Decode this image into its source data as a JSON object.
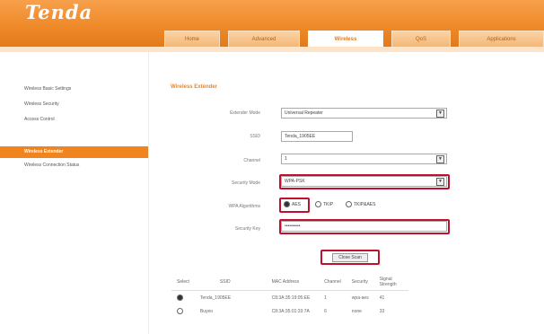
{
  "logo": "Tenda",
  "tabs": [
    "Home",
    "Advanced",
    "Wireless",
    "QoS",
    "Applications"
  ],
  "sidebar": [
    "Wireless Basic Settings",
    "Wireless Security",
    "Access Control",
    "Wireless Extender",
    "Wireless Connection Status"
  ],
  "section_title": "Wireless Extender",
  "fields": {
    "extender_mode": {
      "label": "Extender Mode",
      "value": "Universal Repeater"
    },
    "ssid": {
      "label": "SSID",
      "value": "Tenda_1905EE"
    },
    "channel": {
      "label": "Channel",
      "value": "1"
    },
    "security_mode": {
      "label": "Security Mode",
      "value": "WPA-PSK"
    },
    "wpa_algorithms": {
      "label": "WPA Algorithms",
      "options": [
        "AES",
        "TKIP",
        "TKIP&AES"
      ]
    },
    "security_key": {
      "label": "Security Key",
      "value": "••••••••••"
    }
  },
  "open_scan_label": "Close Scan",
  "table": {
    "headers": [
      "Select",
      "SSID",
      "MAC Address",
      "Channel",
      "Security",
      "Signal Strength"
    ],
    "rows": [
      [
        "Tenda_1905EE",
        "C8:3A:35:19:05:EE",
        "1",
        "wpa-aes",
        "41"
      ],
      [
        "Buyeo",
        "C8:3A:35:01:33:7A",
        "6",
        "none",
        "33"
      ]
    ]
  }
}
